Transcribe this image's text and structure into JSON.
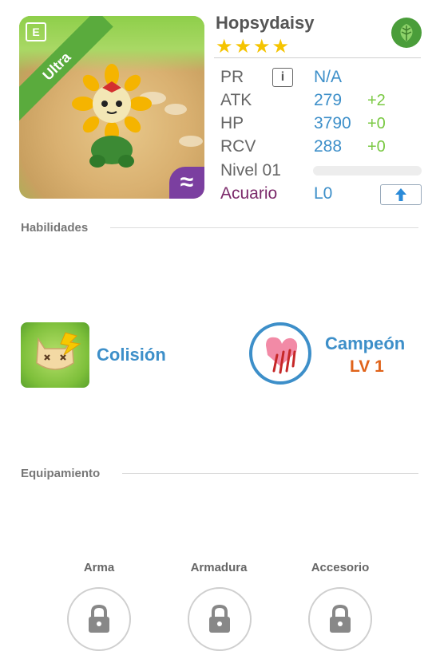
{
  "card": {
    "rarity": "Ultra",
    "element_icon": "leaf-icon",
    "zodiac_icon": "aquarius-icon"
  },
  "header": {
    "name": "Hopsydaisy",
    "stars": "★★★★"
  },
  "stats": {
    "pr": {
      "label": "PR",
      "value": "N/A"
    },
    "atk": {
      "label": "ATK",
      "value": "279",
      "bonus": "+2"
    },
    "hp": {
      "label": "HP",
      "value": "3790",
      "bonus": "+0"
    },
    "rcv": {
      "label": "RCV",
      "value": "288",
      "bonus": "+0"
    },
    "level": {
      "label": "Nivel 01",
      "progress": 0
    },
    "zodiac": {
      "label": "Acuario",
      "value": "L0"
    }
  },
  "skills": {
    "title": "Habilidades",
    "items": [
      {
        "name": "Colisión"
      },
      {
        "name": "Campeón",
        "level": "LV 1"
      }
    ]
  },
  "equipment": {
    "title": "Equipamiento",
    "slots": [
      {
        "label": "Arma"
      },
      {
        "label": "Armadura"
      },
      {
        "label": "Accesorio"
      }
    ]
  },
  "colors": {
    "accent_blue": "#3d8fc9",
    "bonus_green": "#7ac943",
    "zodiac_purple": "#7b2a6a",
    "ribbon_green": "#5aab3d",
    "skill_level_orange": "#e0631a"
  }
}
